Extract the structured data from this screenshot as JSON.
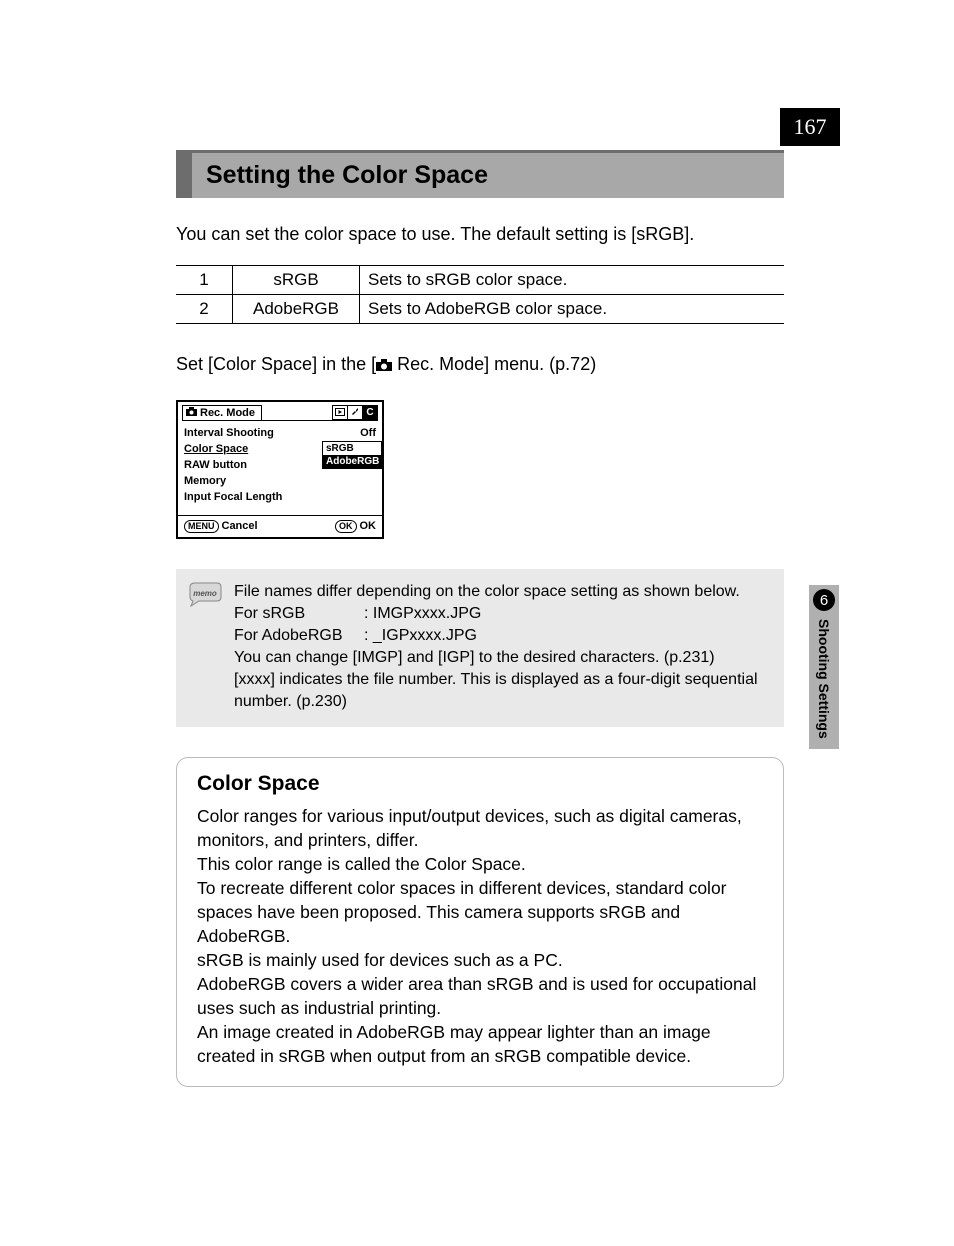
{
  "page_number": "167",
  "side_tab": {
    "number": "6",
    "label": "Shooting Settings"
  },
  "heading": "Setting the Color Space",
  "intro": "You can set the color space to use. The default setting is [sRGB].",
  "table": [
    {
      "num": "1",
      "name": "sRGB",
      "desc": "Sets to sRGB color space."
    },
    {
      "num": "2",
      "name": "AdobeRGB",
      "desc": "Sets to AdobeRGB color space."
    }
  ],
  "instruction": {
    "pre": "Set [Color Space] in the [",
    "post": " Rec. Mode] menu. (p.72)"
  },
  "lcd": {
    "title": "Rec. Mode",
    "right_tabs": [
      "▶",
      "🔧",
      "C"
    ],
    "rows": [
      {
        "label": "Interval Shooting",
        "value": "Off"
      },
      {
        "label": "Color Space",
        "value": "sRGB",
        "underline": true,
        "pointer": true
      },
      {
        "label": "RAW button",
        "value": ""
      },
      {
        "label": "Memory",
        "value": ""
      },
      {
        "label": "Input Focal Length",
        "value": ""
      }
    ],
    "popup": [
      "sRGB",
      "AdobeRGB"
    ],
    "popup_selected": 1,
    "footer": {
      "left_btn": "MENU",
      "left_label": "Cancel",
      "right_btn": "OK",
      "right_label": "OK"
    }
  },
  "memo": {
    "lines": [
      "File names differ depending on the color space setting as shown below.",
      null,
      null,
      "You can change [IMGP] and [IGP] to the desired characters. (p.231)",
      "[xxxx] indicates the file number. This is displayed as a four-digit sequential number. (p.230)"
    ],
    "kv": [
      {
        "k": "For sRGB",
        "sep": ":",
        "v": "IMGPxxxx.JPG"
      },
      {
        "k": "For AdobeRGB",
        "sep": ":",
        "v": "_IGPxxxx.JPG"
      }
    ]
  },
  "info": {
    "title": "Color Space",
    "paragraphs": [
      "Color ranges for various input/output devices, such as digital cameras, monitors, and printers, differ.",
      "This color range is called the Color Space.",
      "To recreate different color spaces in different devices, standard color spaces have been proposed. This camera supports sRGB and AdobeRGB.",
      "sRGB is mainly used for devices such as a PC.",
      "AdobeRGB covers a wider area than sRGB and is used for occupational uses such as industrial printing.",
      "An image created in AdobeRGB may appear lighter than an image created in sRGB when output from an sRGB compatible device."
    ]
  }
}
